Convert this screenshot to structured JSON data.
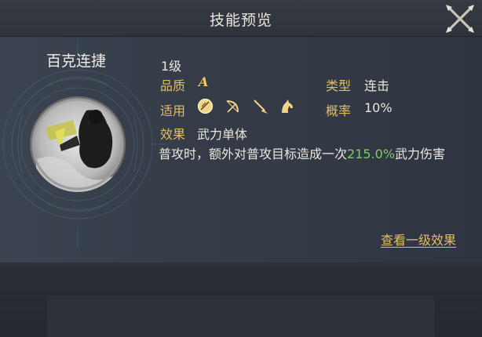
{
  "header": {
    "title": "技能预览"
  },
  "skill": {
    "name": "百克连捷",
    "level": "1级",
    "quality_label": "品质",
    "quality_value": "A",
    "type_label": "类型",
    "type_value": "连击",
    "apply_label": "适用",
    "troop_icons": [
      "shield-troop-icon",
      "bow-troop-icon",
      "spear-troop-icon",
      "cavalry-troop-icon"
    ],
    "rate_label": "概率",
    "rate_value": "10%",
    "effect_label": "效果",
    "effect_value": "武力单体",
    "desc_before": "普攻时，额外对普攻目标造成一次",
    "desc_highlight": "215.0%",
    "desc_after": "武力伤害"
  },
  "actions": {
    "view_level1": "查看一级效果"
  },
  "colors": {
    "label": "#e2bd62",
    "highlight": "#7ccf5d",
    "grade": "#f2cd54"
  }
}
